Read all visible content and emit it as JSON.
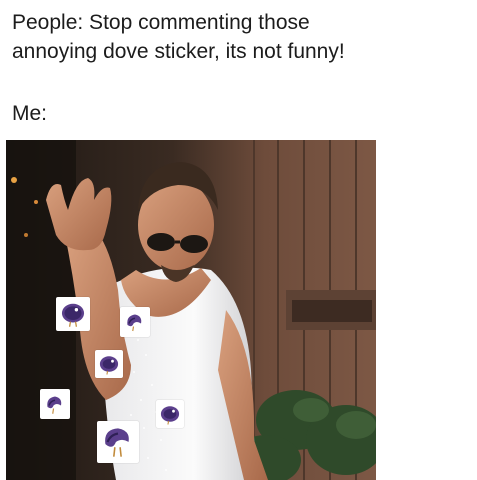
{
  "meme": {
    "caption_line1": "People: Stop commenting those",
    "caption_line2": "annoying dove sticker, its not funny!",
    "me_label": "Me:"
  },
  "image": {
    "subject": "man in white tank top and sunglasses sprinkling salt with raised hand",
    "stickers": [
      {
        "icon": "dove-sticker-icon",
        "pose": "round"
      },
      {
        "icon": "dove-sticker-icon",
        "pose": "peck"
      },
      {
        "icon": "dove-sticker-icon",
        "pose": "round"
      },
      {
        "icon": "dove-sticker-icon",
        "pose": "peck"
      },
      {
        "icon": "dove-sticker-icon",
        "pose": "round"
      },
      {
        "icon": "dove-sticker-icon",
        "pose": "peck"
      }
    ],
    "colors": {
      "dove_purple": "#5b3f8c",
      "dove_dark": "#2f2056",
      "tank_top": "#f2f2f2",
      "wood_wall": "#6b4a3a"
    }
  }
}
